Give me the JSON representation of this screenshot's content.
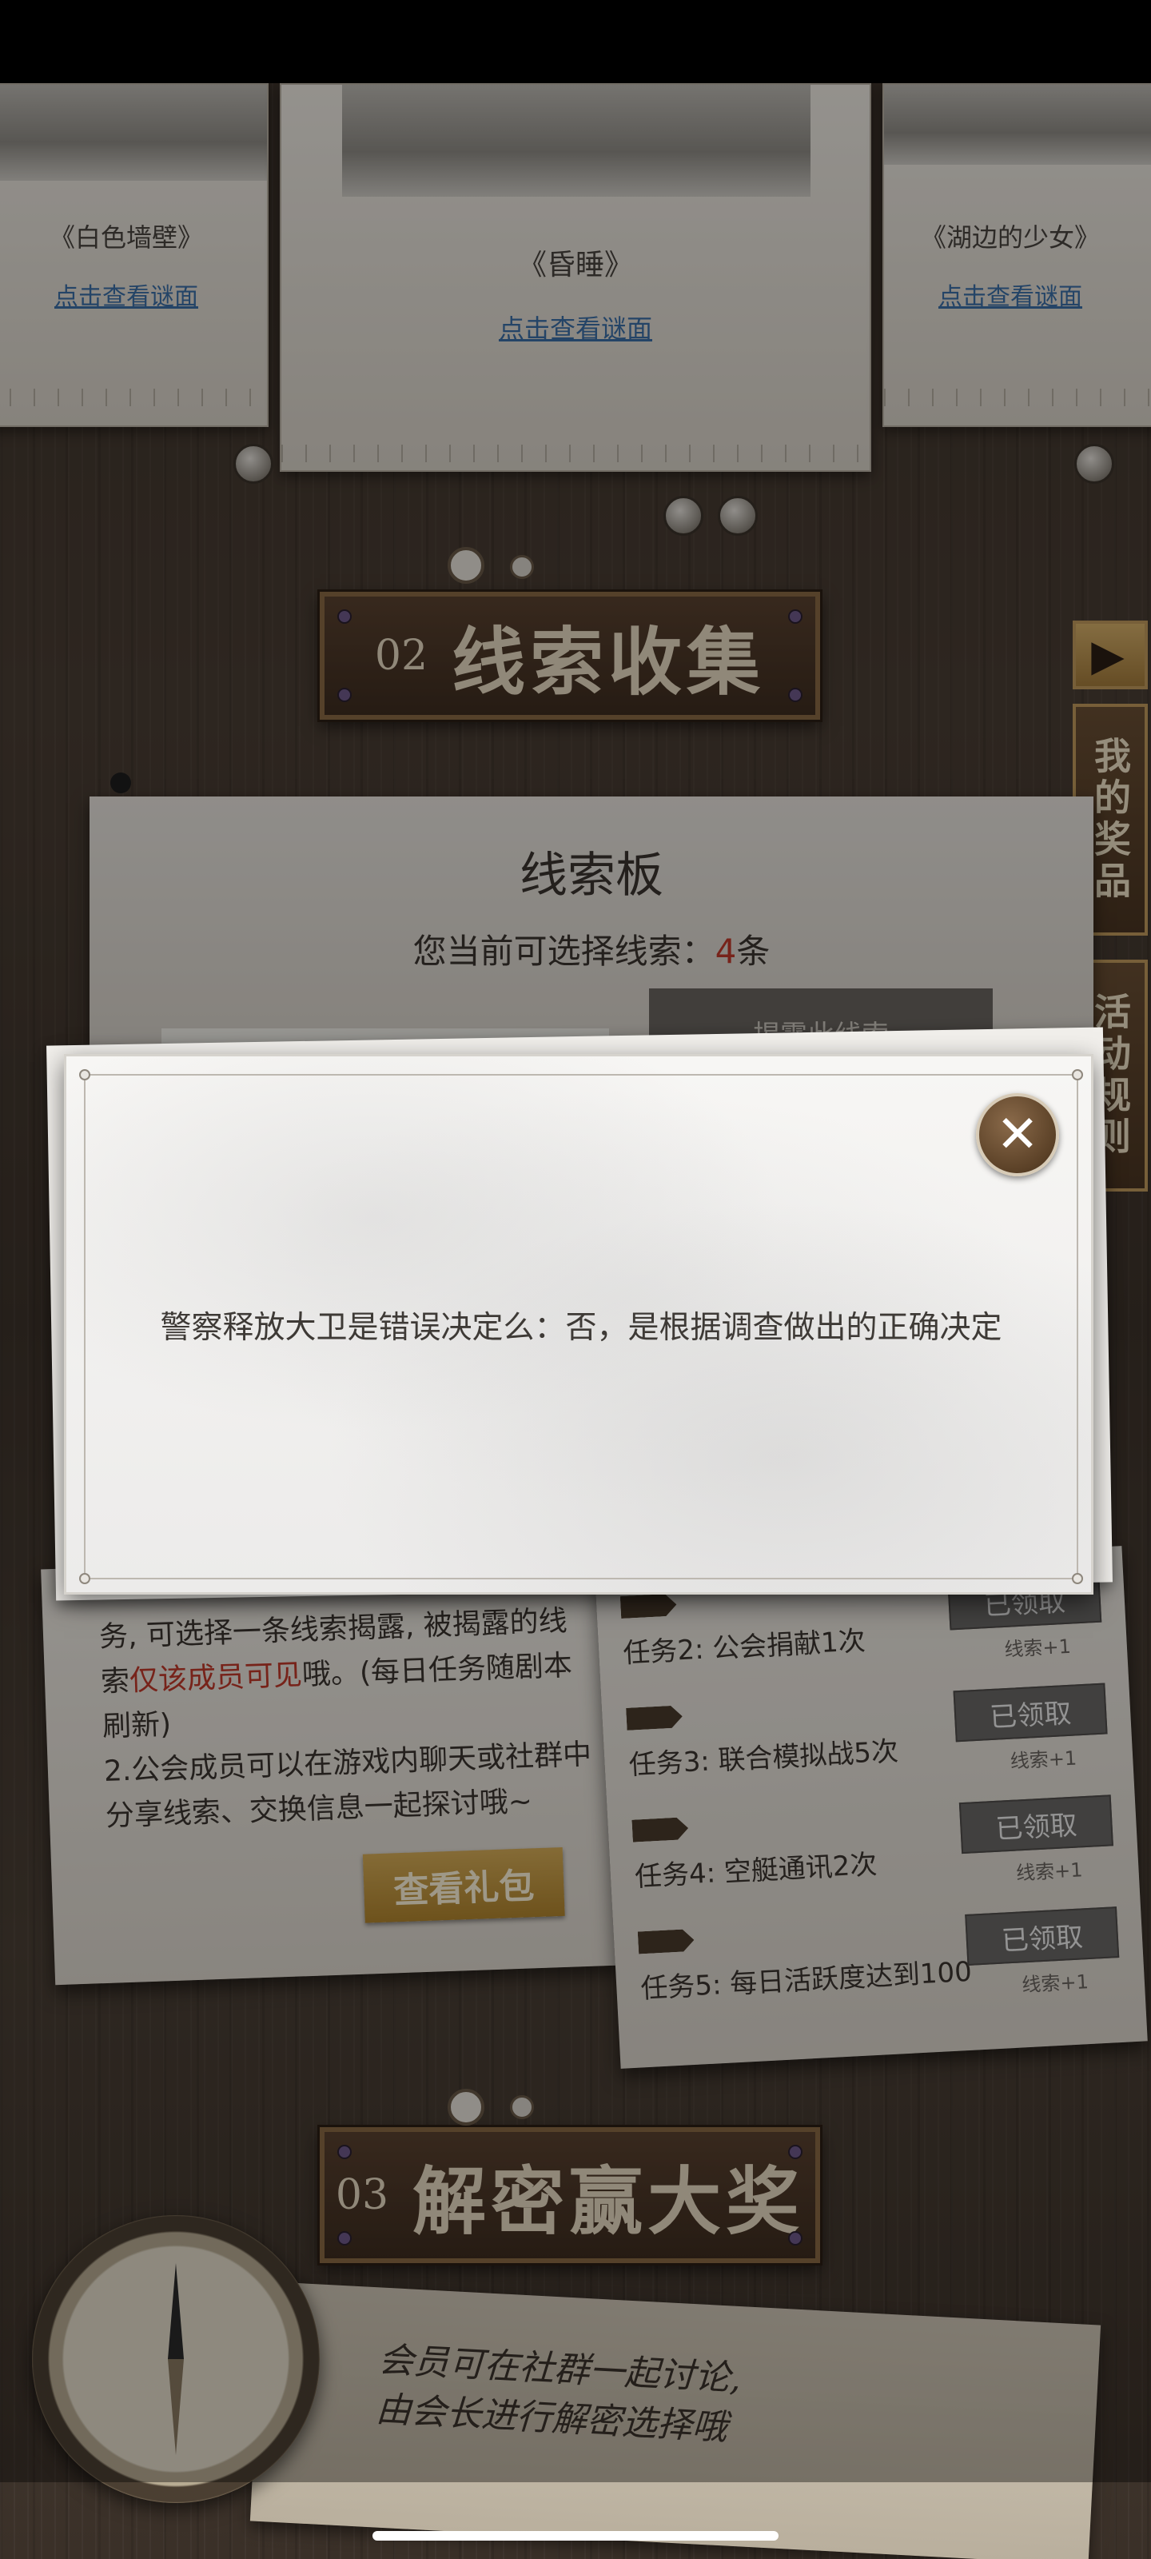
{
  "stories": [
    {
      "title": "《白色墙壁》",
      "link": "点击查看谜面"
    },
    {
      "title": "《昏睡》",
      "link": "点击查看谜面"
    },
    {
      "title": "《湖边的少女》",
      "link": "点击查看谜面"
    }
  ],
  "sections": {
    "clue_collection": {
      "number": "02",
      "title": "线索收集"
    },
    "decode_prize": {
      "number": "03",
      "title": "解密赢大奖"
    }
  },
  "side_tabs": {
    "my_prizes": "我的奖品",
    "rules": "活动规则",
    "arrow": "▶"
  },
  "clue_board": {
    "title": "线索板",
    "count_prefix": "您当前可选择线索：",
    "count_value": "4",
    "count_suffix": "条",
    "peek_text": "警察释放大卫是错误决定么",
    "select_button": "揭露此线索"
  },
  "notebook": {
    "line_before": "务, 可选择一条线索揭露, 被揭露的线索",
    "line_highlight": "仅该成员可见",
    "line_after": "哦。(每日任务随剧本刷新)",
    "line_2": "2.公会成员可以在游戏内聊天或社群中分享线索、交换信息一起探讨哦~",
    "gift_button": "查看礼包"
  },
  "tasks": [
    {
      "label": "任务2: 公会捐献1次",
      "claim": "已领取",
      "reward": "线索+1"
    },
    {
      "label": "任务3: 联合模拟战5次",
      "claim": "已领取",
      "reward": "线索+1"
    },
    {
      "label": "任务4: 空艇通讯2次",
      "claim": "已领取",
      "reward": "线索+1"
    },
    {
      "label": "任务5: 每日活跃度达到100",
      "claim": "已领取",
      "reward": "线索+1"
    }
  ],
  "map_note": {
    "line1": "会员可在社群一起讨论,",
    "line2": "由会长进行解密选择哦"
  },
  "modal": {
    "message": "警察释放大卫是错误决定么：否，是根据调查做出的正确决定",
    "close_glyph": "✕"
  },
  "colors": {
    "accent_red": "#c0392b",
    "link_blue": "#3b6fa6",
    "gold_button": "#c79a42",
    "close_brown": "#5b4127"
  }
}
